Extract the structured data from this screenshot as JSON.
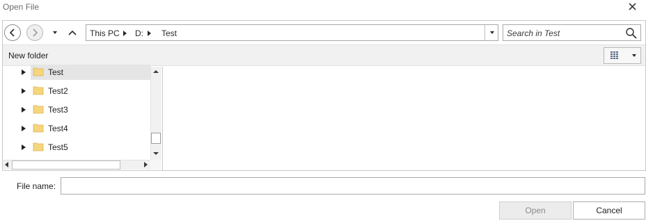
{
  "window": {
    "title": "Open File",
    "close_icon": "close-icon"
  },
  "nav": {
    "back_icon": "arrow-left-icon",
    "forward_icon": "arrow-right-icon",
    "recent_icon": "chevron-down-icon",
    "up_icon": "arrow-up-icon"
  },
  "address": {
    "crumbs": [
      "This PC",
      "D:",
      "Test"
    ]
  },
  "search": {
    "placeholder": "Search in Test",
    "icon": "search-icon"
  },
  "toolbar": {
    "new_folder_label": "New folder",
    "view_icon": "grid-view-icon"
  },
  "tree": {
    "items": [
      {
        "label": "Test",
        "selected": true
      },
      {
        "label": "Test2",
        "selected": false
      },
      {
        "label": "Test3",
        "selected": false
      },
      {
        "label": "Test4",
        "selected": false
      },
      {
        "label": "Test5",
        "selected": false
      }
    ]
  },
  "footer": {
    "file_name_label": "File name:",
    "file_name_value": "",
    "open_label": "Open",
    "cancel_label": "Cancel"
  },
  "colors": {
    "selection": "#e5e5e5",
    "folder": "#f6d67d",
    "disabled_button": "#ececec"
  }
}
